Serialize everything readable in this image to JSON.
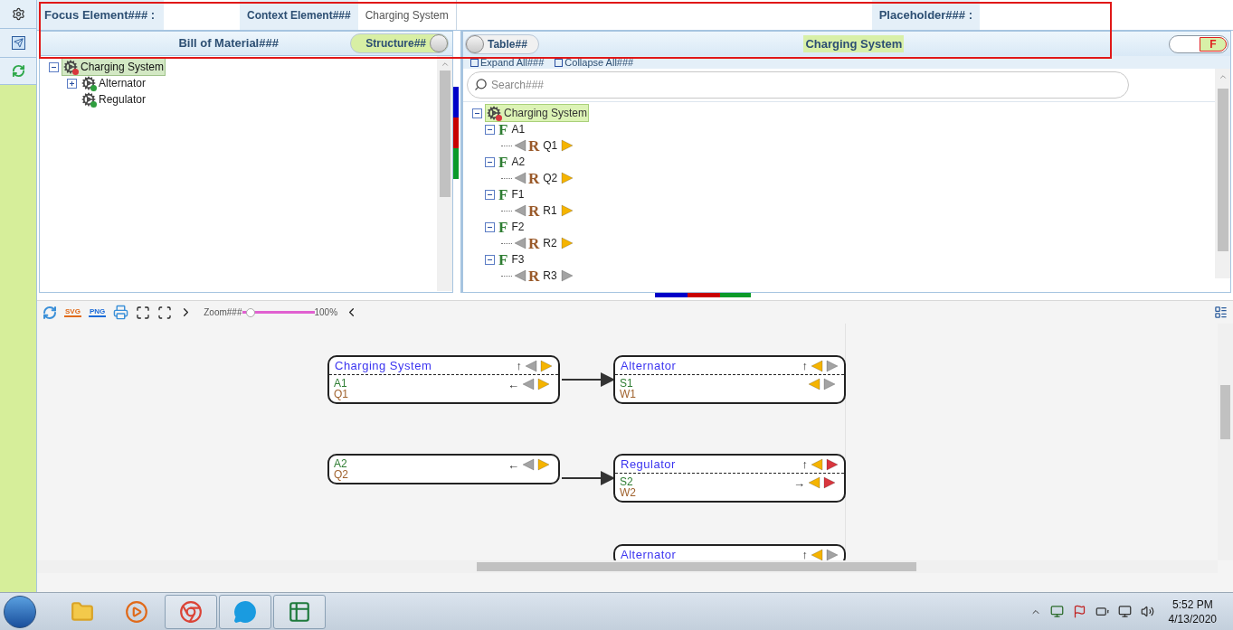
{
  "top_bar": {
    "focus_label": "Focus Element### :",
    "context_label": "Context Element###",
    "context_value": "Charging System",
    "placeholder_label": "Placeholder### :"
  },
  "bom_panel": {
    "title": "Bill of Material###",
    "toggle": {
      "label": "Structure##",
      "on": true
    },
    "tree": [
      {
        "label": "Charging System",
        "selected": true,
        "expanded": true,
        "children": [
          {
            "label": "Alternator",
            "selected": false,
            "expanded": false
          },
          {
            "label": "Regulator",
            "selected": false
          }
        ]
      }
    ]
  },
  "table_panel": {
    "toggle": {
      "label": "Table##",
      "on": false
    },
    "title": "Charging System",
    "filter_toggle": {
      "label": "F",
      "on": true
    },
    "expand_all": "Expand All###",
    "collapse_all": "Collapse All###",
    "search": {
      "placeholder": "Search###"
    },
    "tree": {
      "label": "Charging System",
      "selected": true,
      "expanded": true,
      "children": [
        {
          "letter": "F",
          "label": "A1",
          "expanded": true,
          "children": [
            {
              "letter": "R",
              "label": "Q1",
              "forward_active": true
            }
          ]
        },
        {
          "letter": "F",
          "label": "A2",
          "expanded": true,
          "children": [
            {
              "letter": "R",
              "label": "Q2",
              "forward_active": true
            }
          ]
        },
        {
          "letter": "F",
          "label": "F1",
          "expanded": true,
          "children": [
            {
              "letter": "R",
              "label": "R1",
              "forward_active": true
            }
          ]
        },
        {
          "letter": "F",
          "label": "F2",
          "expanded": true,
          "children": [
            {
              "letter": "R",
              "label": "R2",
              "forward_active": true
            }
          ]
        },
        {
          "letter": "F",
          "label": "F3",
          "expanded": true,
          "children": [
            {
              "letter": "R",
              "label": "R3",
              "forward_active": false
            }
          ]
        }
      ]
    }
  },
  "toolbar": {
    "export_svg": "SVG",
    "export_png": "PNG",
    "zoom": {
      "label": "Zoom###",
      "level": 0.12,
      "reading": "100%"
    }
  },
  "canvas": {
    "nodes": [
      {
        "title": "Charging System",
        "header": {
          "arrow": "↑",
          "left_active": false,
          "right_active": true,
          "right_alert": false
        },
        "lines": [
          "A1",
          "Q1"
        ],
        "body": {
          "arrow": "←",
          "left_active": false,
          "right_active": true,
          "right_alert": false
        }
      },
      {
        "title": "Alternator",
        "header": {
          "arrow": "↑",
          "left_active": true,
          "right_active": false,
          "right_alert": false
        },
        "lines": [
          "S1",
          "W1"
        ],
        "body": {
          "left_active": true,
          "right_active": false,
          "right_alert": false
        }
      },
      {
        "lines": [
          "A2",
          "Q2"
        ],
        "body": {
          "arrow": "←",
          "left_active": false,
          "right_active": true,
          "right_alert": false
        }
      },
      {
        "title": "Regulator",
        "header": {
          "arrow": "↑",
          "left_active": true,
          "right_active": false,
          "right_alert": true
        },
        "lines": [
          "S2",
          "W2"
        ],
        "body": {
          "arrow": "→",
          "left_active": true,
          "right_active": false,
          "right_alert": true
        }
      },
      {
        "title": "Alternator",
        "header": {
          "arrow": "↑",
          "left_active": true,
          "right_active": false,
          "right_alert": false
        }
      }
    ]
  },
  "taskbar": {
    "apps": [
      {
        "kind": "folder",
        "running": false
      },
      {
        "kind": "media",
        "running": false
      },
      {
        "kind": "browser",
        "running": true
      },
      {
        "kind": "chat",
        "running": true
      },
      {
        "kind": "spreadsheet",
        "running": true
      }
    ],
    "time": "5:52 PM",
    "date": "4/13/2020"
  }
}
